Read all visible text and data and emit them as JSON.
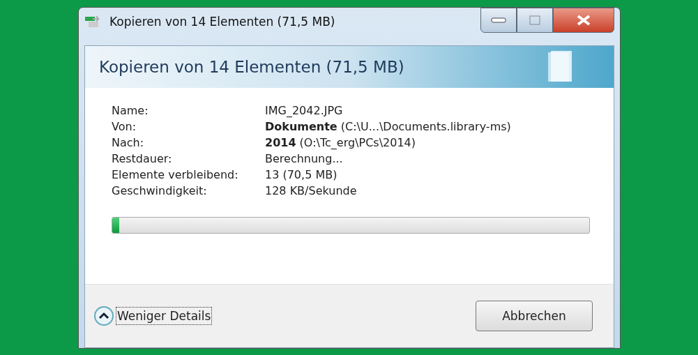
{
  "window": {
    "title": "Kopieren von 14 Elementen (71,5 MB)"
  },
  "header": {
    "title": "Kopieren von 14 Elementen (71,5 MB)"
  },
  "details": [
    {
      "label": "Name:",
      "value": "IMG_2042.JPG"
    },
    {
      "label": "Von:",
      "value": "**Dokumente** (C:\\U...\\Documents.library-ms)"
    },
    {
      "label": "Nach:",
      "value": "**2014** (O:\\Tc_erg\\PCs\\2014)"
    },
    {
      "label": "Restdauer:",
      "value": "Berechnung..."
    },
    {
      "label": "Elemente verbleibend:",
      "value": "13 (70,5 MB)"
    },
    {
      "label": "Geschwindigkeit:",
      "value": "128 KB/Sekunde"
    }
  ],
  "progress": {
    "level": 0.015
  },
  "footer": {
    "details_toggle": {
      "label": "Weniger Details",
      "expanded": true
    },
    "cancel_button": "Abbrechen"
  }
}
